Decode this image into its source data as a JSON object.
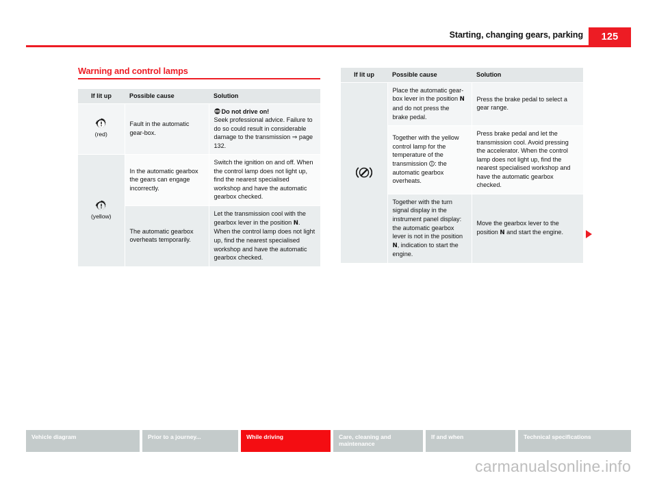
{
  "header": {
    "title": "Starting, changing gears, parking",
    "page_number": "125",
    "accent_color": "#ed1c24"
  },
  "section": {
    "heading": "Warning and control lamps"
  },
  "tables": {
    "left": {
      "columns": [
        "If lit up",
        "Possible cause",
        "Solution"
      ],
      "rows": [
        {
          "icon": "gear-warning-icon",
          "icon_color_label": "(red)",
          "cause": "Fault in the automatic gear-box.",
          "solution_lead": "Do not drive on!",
          "solution_lead_icon": "do-not-drive-icon",
          "solution": "Seek professional advice. Failure to do so could result in considerable damage to the transmission ⇒ page 132."
        },
        {
          "icon": "gear-warning-icon",
          "icon_color_label": "(yellow)",
          "cause": "In the automatic gearbox the gears can engage incorrectly.",
          "solution": "Switch the ignition on and off. When the control lamp does not light up, find the nearest specialised workshop and have the automatic gearbox checked."
        },
        {
          "cause": "The automatic gearbox overheats temporarily.",
          "solution_part1": "Let the transmission cool with the gearbox lever in the position ",
          "gear_position": "N",
          "solution_part2": ". When the control lamp does not light up, find the nearest specialised workshop and have the automatic gearbox checked."
        }
      ]
    },
    "right": {
      "columns": [
        "If lit up",
        "Possible cause",
        "Solution"
      ],
      "icon": "brake-pedal-prohibited-icon",
      "rows": [
        {
          "cause_part1": "Place the automatic gear-box lever in the position ",
          "gear_position": "N",
          "cause_part2": " and do not press the brake pedal.",
          "solution": "Press the brake pedal to select a gear range."
        },
        {
          "cause_part1": "Together with the yellow control lamp for the temperature of the transmission ",
          "temp_icon": "transmission-temperature-icon",
          "cause_part2": ": the automatic gearbox overheats.",
          "solution": "Press brake pedal and let the transmission cool. Avoid pressing the accelerator. When the control lamp does not light up, find the nearest specialised workshop and have the automatic gearbox checked."
        },
        {
          "cause_part1": "Together with the turn signal display in the instrument panel display: the automatic gearbox lever is not in the position ",
          "gear_position": "N",
          "cause_part2": ", indication to start the engine.",
          "solution_part1": "Move the gearbox lever to the position ",
          "solution_gear_position": "N",
          "solution_part2": " and start the engine."
        }
      ]
    }
  },
  "footer": {
    "items": [
      {
        "label": "Vehicle diagram",
        "active": false
      },
      {
        "label": "Prior to a journey...",
        "active": false
      },
      {
        "label": "While driving",
        "active": true
      },
      {
        "label": "Care, cleaning and maintenance",
        "active": false
      },
      {
        "label": "If and when",
        "active": false
      },
      {
        "label": "Technical specifications",
        "active": false
      }
    ],
    "active_color": "#f40d12",
    "inactive_color": "#c4cbcb"
  },
  "watermark": "carmanualsonline.info"
}
